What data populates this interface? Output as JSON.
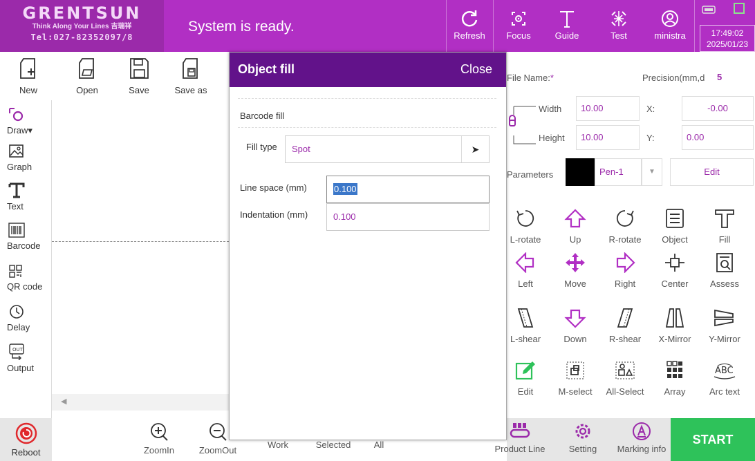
{
  "header": {
    "brand": "GRENTSUN",
    "tagline": "Think Along Your Lines 吉瑞祥",
    "tel": "Tel:027-82352097/8",
    "status": "System is ready.",
    "buttons": {
      "refresh": "Refresh",
      "focus": "Focus",
      "guide": "Guide",
      "test": "Test",
      "user": "ministra"
    },
    "time": "17:49:02",
    "date": "2025/01/23"
  },
  "file_toolbar": {
    "new": "New",
    "open": "Open",
    "save": "Save",
    "save_as": "Save as"
  },
  "draw_toolbar": {
    "draw": "Draw",
    "graph": "Graph",
    "text": "Text",
    "barcode": "Barcode",
    "qrcode": "QR code",
    "delay": "Delay",
    "output": "Output"
  },
  "bottom": {
    "reboot": "Reboot",
    "zoom_in": "ZoomIn",
    "zoom_out": "ZoomOut",
    "work": "Work",
    "selected": "Selected",
    "all": "All",
    "product_line": "Product Line",
    "setting": "Setting",
    "marking_info": "Marking info",
    "start": "START"
  },
  "dialog": {
    "title": "Object fill",
    "close": "Close",
    "section": "Barcode fill",
    "fill_type_label": "Fill type",
    "fill_type_value": "Spot",
    "line_space_label": "Line space (mm)",
    "line_space_value": "0.100",
    "indentation_label": "Indentation (mm)",
    "indentation_value": "0.100"
  },
  "props": {
    "file_name_label": "File Name:",
    "precision_label": "Precision(mm,d",
    "precision_value": "5",
    "width_label": "Width",
    "width_value": "10.00",
    "height_label": "Height",
    "height_value": "10.00",
    "x_label": "X:",
    "x_value": "-0.00",
    "y_label": "Y:",
    "y_value": "0.00",
    "parameters_label": "Parameters",
    "pen_value": "Pen-1",
    "edit_button": "Edit"
  },
  "tools": [
    {
      "label": "L-rotate",
      "icon": "rotate-left-icon"
    },
    {
      "label": "Up",
      "icon": "arrow-up-icon"
    },
    {
      "label": "R-rotate",
      "icon": "rotate-right-icon"
    },
    {
      "label": "Object",
      "icon": "object-list-icon"
    },
    {
      "label": "Fill",
      "icon": "fill-icon"
    },
    {
      "label": "Left",
      "icon": "arrow-left-icon"
    },
    {
      "label": "Move",
      "icon": "move-icon"
    },
    {
      "label": "Right",
      "icon": "arrow-right-icon"
    },
    {
      "label": "Center",
      "icon": "center-icon"
    },
    {
      "label": "Assess",
      "icon": "assess-icon"
    },
    {
      "label": "L-shear",
      "icon": "shear-left-icon"
    },
    {
      "label": "Down",
      "icon": "arrow-down-icon"
    },
    {
      "label": "R-shear",
      "icon": "shear-right-icon"
    },
    {
      "label": "X-Mirror",
      "icon": "mirror-x-icon"
    },
    {
      "label": "Y-Mirror",
      "icon": "mirror-y-icon"
    },
    {
      "label": "Edit",
      "icon": "edit-icon"
    },
    {
      "label": "M-select",
      "icon": "multi-select-icon"
    },
    {
      "label": "All-Select",
      "icon": "select-all-icon"
    },
    {
      "label": "Array",
      "icon": "array-icon"
    },
    {
      "label": "Arc text",
      "icon": "arc-text-icon"
    }
  ],
  "colors": {
    "header": "#b12fc4",
    "logo_bg": "#9b2aaa",
    "dialog_header": "#62128a",
    "accent": "#9b2aaa",
    "start": "#2ec25a"
  }
}
